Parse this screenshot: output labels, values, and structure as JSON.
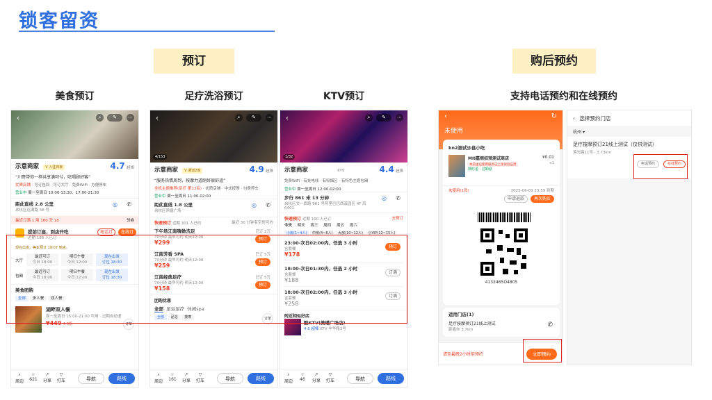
{
  "slide": {
    "title": "锁客留资",
    "badge_booking": "预订",
    "badge_after": "购后预约",
    "sub_food": "美食预订",
    "sub_foot": "足疗洗浴预订",
    "sub_ktv": "KTV预订",
    "sub_after": "支持电话预约和在线预约"
  },
  "food": {
    "shop": "示意商家",
    "vtag": "V 入驻商家",
    "score": "4.7",
    "score_tag": "超棒",
    "quote": "“川哥带你一样共享满叼兮，吃喝顾好客”",
    "tags": [
      "优质店铺",
      "可订包间",
      "可订大厅",
      "免费WiFi",
      "方便停车"
    ],
    "status": "营业中",
    "hours": "周一至周日 10:00-13:30、17:00-21:30",
    "distance": "距此直线 2.8 公里",
    "address": "余杭区远满路 58 号",
    "map": "地图",
    "phone": "电话",
    "promo": "最近订满 1 用 180 天 18",
    "promo_more": "领券",
    "res_title": "提前订座，到店开吃",
    "res_sub": "近期 186 人已订",
    "btn_call": "电话订",
    "btn_online": "在线订",
    "wait": "现在出发，等车预计 19:07 到店。",
    "rows": [
      {
        "type": "大厅",
        "c1": "最近可订",
        "c1s": "今日 18:00",
        "c2": "明日午餐",
        "c2s": "今日 12:00",
        "c3": "现在出发",
        "c3s": "订位 18:30"
      },
      {
        "type": "包厢",
        "c1": "最近可订",
        "c1s": "今日 18:00",
        "c2": "明日午餐",
        "c2s": "今日 12:00",
        "c3": "现在出发",
        "c3s": "订位 18:30"
      }
    ],
    "group_title": "美食团购",
    "group_tabs": [
      "全部",
      "多人餐",
      "双人餐"
    ],
    "deal_name": "湖畔双人餐",
    "deal_time": "周一至周日 15:00-21:00 可用 · 过期自动退",
    "deal_price": "¥449",
    "deal_disc": "4.5折",
    "bottom": [
      "周边",
      "分享",
      "分享",
      "打车"
    ],
    "bottom_count": "621",
    "nav": "导航",
    "route": "路线",
    "float": "订单"
  },
  "foot": {
    "pic_count": "4/153",
    "shop": "示意商家",
    "vtag": "V 通道2家",
    "score": "4.9",
    "score_tag": "超棒",
    "quote": "“服务热情周到，按摩力道刚好很舒适”",
    "tags": [
      "全机主题推荐(足疗 第13名)",
      "优质店铺",
      "中式按摩",
      "付费停车"
    ],
    "status": "营业中",
    "hours": "周一至周日 11:00-02:00",
    "distance": "距此直线 1.8 公里",
    "address": "余杭区滨疆广场",
    "map": "地图",
    "phone": "电话",
    "quick": "快速预订",
    "quick_sub": "近期 301 人已约",
    "quick_right": "最近 30 分钟有空房可约",
    "items": [
      {
        "name": "下午场江南嗨做洗足",
        "meta": "70分钟 最早可约 明天12:00",
        "price": "¥299",
        "sold": "已订 2万",
        "btn": "预订"
      },
      {
        "name": "江南芳香 SPA",
        "meta": "70分钟 最早可约 明天12:00",
        "price": "¥259",
        "sold": "已订 5万",
        "btn": "预订"
      },
      {
        "name": "江南经典足疗",
        "meta": "70分钟 最早可约 明天12:00",
        "price": "¥158",
        "sold": "已订 5万",
        "btn": "预订"
      }
    ],
    "group_title": "团购优惠",
    "tabs": [
      "全部",
      "足浴足疗",
      "休闲spa"
    ],
    "pill_tabs": [
      "全部",
      "足浴",
      "按摩"
    ],
    "bottom": [
      "周边",
      "分享",
      "分享",
      "打车"
    ],
    "bottom_count": "161",
    "nav": "导航",
    "route": "路线",
    "float": "订单"
  },
  "ktv": {
    "pic_count": "1/32",
    "shop": "示意商家",
    "tag": "KTV",
    "score": "4.4",
    "score_tag": "超棒",
    "tags": [
      "免费WiFi",
      "有充电线",
      "有吸烟区",
      "有特色主题包厢"
    ],
    "status": "营业中",
    "hours": "周一至周日 12:00-02:00",
    "distance": "步行 861 米  13 分钟",
    "address": "余杭区文一西路 961 号阿里巴巴西溪园区 4F 后 6401",
    "map": "地图",
    "phone": "电话",
    "quick": "快速预订",
    "quick_sub": "近期 160 人已订",
    "quick_right": "去预订",
    "dates": [
      "今天",
      "明天",
      "周三",
      "周四",
      "周五",
      "周六"
    ],
    "room_tabs": [
      "小房(1~4人)",
      "中房(4~8人)",
      "大房(10~12人)",
      "小VIP(12~15人)"
    ],
    "slots": [
      {
        "time": "23:00-次日02:00内，任选 3 小时",
        "note": "含套餐",
        "price": "¥178",
        "btn": "预订"
      },
      {
        "time": "18:00-次日01:30内，任选 2 小时",
        "note": "含套餐",
        "price": "¥188",
        "btn": "订满"
      },
      {
        "time": "18:00-次日02:00内，任选 3 小时",
        "note": "含套餐",
        "price": "¥258",
        "btn": "订满"
      }
    ],
    "nearby": "附近相似好店",
    "near_name": "魅KTV(美瑾广场店)",
    "near_score": "4.6 超棒",
    "near_meta": "KTV 丰华路3号",
    "bottom": [
      "周边",
      "分享",
      "分享",
      "打车"
    ],
    "bottom_count": "46",
    "nav": "导航",
    "route": "路线"
  },
  "after": {
    "unused": "未使用",
    "order_title": "kn2测试沙县小吃",
    "order_item": "MH嘉雨招预测试商店",
    "order_tag": "本店由已使用服务已上架试验应用",
    "order_price": "¥0.01",
    "order_qty": "x1",
    "order_flags": [
      "随时退",
      "过期退"
    ],
    "unused_count": "未使用(1张)",
    "expire": "2025-06-09 23:59 到期",
    "btn_refund": "申请退款",
    "btn_buy": "再次购买",
    "code": "4132465O4805",
    "store_title": "适用门店(1)",
    "store_name": "足疗按摩预订21线上测试",
    "store_addr": "距离你 3.7km",
    "footer_note": "请至最晚2小时前预约",
    "btn_reserve": "立即预约",
    "sel_title": "选择预约门店",
    "city": "杭州",
    "sel_store": "足疗按摩预订21线上测试（仅供测试）",
    "sel_addr": "滨光路11号 · 3.73km",
    "sel_call": "电话预约",
    "sel_online": "在线预约"
  },
  "colors": {
    "accent": "#2f6fe0",
    "orange": "#ff6a1a",
    "red_frame": "#e02020",
    "badge": "#fdf0c4"
  }
}
